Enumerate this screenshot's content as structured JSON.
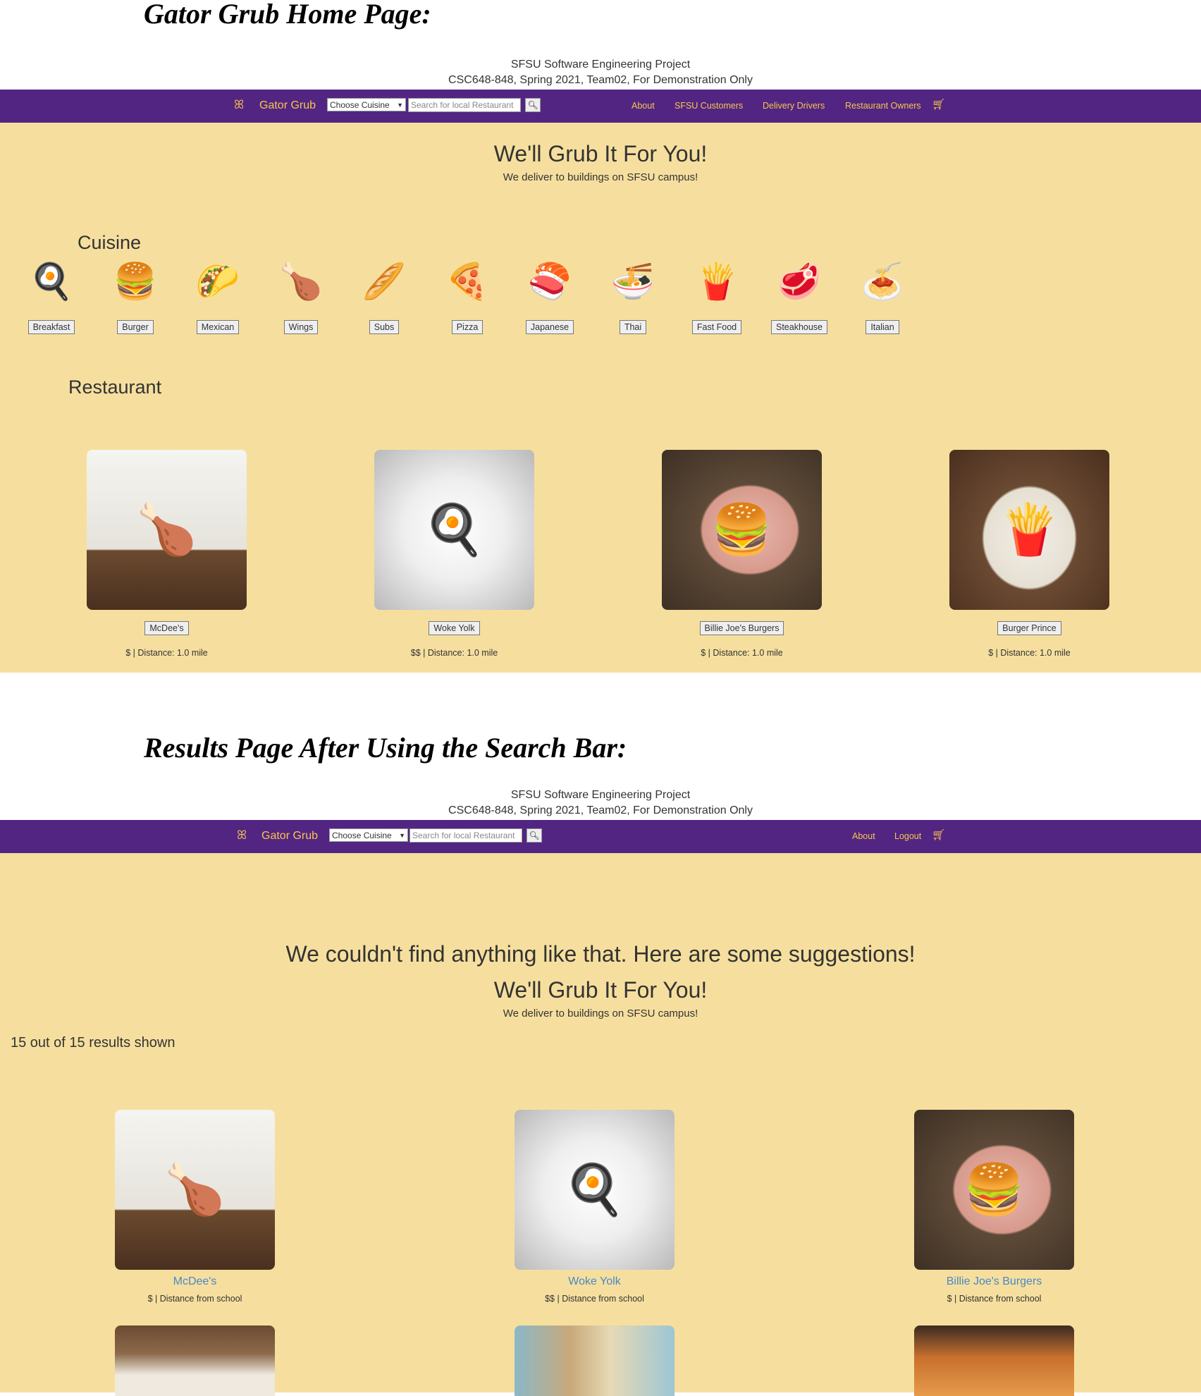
{
  "colors": {
    "navbar": "#522583",
    "nav_text": "#f7c64c",
    "page_bg": "#f6df9e",
    "link": "#4a87c8"
  },
  "home": {
    "heading": "Gator Grub Home Page:",
    "project_line1": "SFSU Software Engineering Project",
    "project_line2": "CSC648-848, Spring 2021, Team02, For Demonstration Only",
    "nav": {
      "logo_icon": "sf-logo-icon",
      "brand": "Gator Grub",
      "cuisine_select": "Choose Cuisine",
      "search_placeholder": "Search for local Restaurant",
      "search_icon": "search-icon",
      "links": [
        "About",
        "SFSU Customers",
        "Delivery Drivers",
        "Restaurant Owners"
      ],
      "cart_icon": "cart-icon"
    },
    "tagline": "We'll Grub It For You!",
    "subtagline": "We deliver to buildings on SFSU campus!",
    "cuisine_label": "Cuisine",
    "cuisines": [
      {
        "label": "Breakfast",
        "icon": "fried-egg-icon"
      },
      {
        "label": "Burger",
        "icon": "burger-icon"
      },
      {
        "label": "Mexican",
        "icon": "nachos-icon"
      },
      {
        "label": "Wings",
        "icon": "drumstick-icon"
      },
      {
        "label": "Subs",
        "icon": "sub-sandwich-icon"
      },
      {
        "label": "Pizza",
        "icon": "pizza-slice-icon"
      },
      {
        "label": "Japanese",
        "icon": "sushi-icon"
      },
      {
        "label": "Thai",
        "icon": "noodle-bowl-icon"
      },
      {
        "label": "Fast Food",
        "icon": "fries-icon"
      },
      {
        "label": "Steakhouse",
        "icon": "steak-icon"
      },
      {
        "label": "Italian",
        "icon": "pasta-icon"
      }
    ],
    "restaurant_label": "Restaurant",
    "restaurants": [
      {
        "name": "McDee's",
        "meta": "$ | Distance: 1.0 mile",
        "image": "chicken-nuggets-photo"
      },
      {
        "name": "Woke Yolk",
        "meta": "$$ | Distance: 1.0 mile",
        "image": "egg-toast-photo"
      },
      {
        "name": "Billie Joe's Burgers",
        "meta": "$ | Distance: 1.0 mile",
        "image": "burger-fries-plate-photo"
      },
      {
        "name": "Burger Prince",
        "meta": "$ | Distance: 1.0 mile",
        "image": "burger-fries-photo"
      }
    ]
  },
  "results": {
    "heading": "Results Page After Using the Search Bar:",
    "project_line1": "SFSU Software Engineering Project",
    "project_line2": "CSC648-848, Spring 2021, Team02, For Demonstration Only",
    "nav": {
      "brand": "Gator Grub",
      "cuisine_select": "Choose Cuisine",
      "search_placeholder": "Search for local Restaurant",
      "links": [
        "About",
        "Logout"
      ]
    },
    "no_results": "We couldn't find anything like that. Here are some suggestions!",
    "tagline": "We'll Grub It For You!",
    "subtagline": "We deliver to buildings on SFSU campus!",
    "count": "15 out of 15 results shown",
    "restaurants": [
      {
        "name": "McDee's",
        "meta": "$ | Distance from school",
        "image": "chicken-nuggets-photo"
      },
      {
        "name": "Woke Yolk",
        "meta": "$$ | Distance from school",
        "image": "egg-toast-photo"
      },
      {
        "name": "Billie Joe's Burgers",
        "meta": "$ | Distance from school",
        "image": "burger-fries-plate-photo"
      }
    ],
    "partial_images": [
      "burger-plate-photo",
      "tortilla-photo",
      "fried-chicken-photo"
    ]
  }
}
